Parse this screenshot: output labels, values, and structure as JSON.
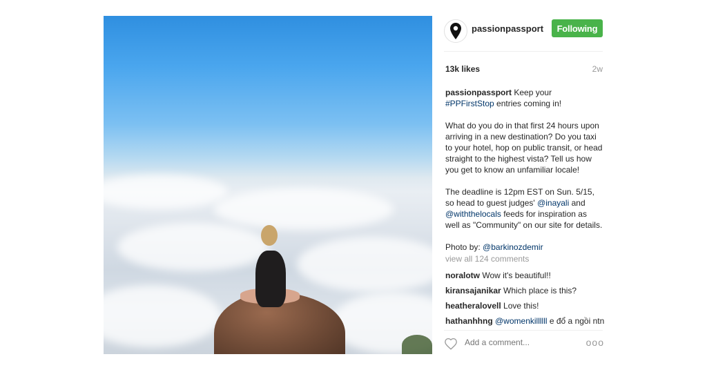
{
  "post": {
    "image_alt": "Person sitting on a rock above a sea of clouds"
  },
  "header": {
    "username": "passionpassport",
    "follow_label": "Following",
    "avatar_icon": "location-pin-icon"
  },
  "stats": {
    "likes": "13k likes",
    "time": "2w"
  },
  "caption": {
    "username": "passionpassport",
    "p1_text_a": " Keep your ",
    "hashtag": "#PPFirstStop",
    "p1_text_b": " entries coming in!",
    "p2": "What do you do in that first 24 hours upon arriving in a new destination? Do you taxi to your hotel, hop on public transit, or head straight to the highest vista? Tell us how you get to know an unfamiliar locale!",
    "p3_a": "The deadline is 12pm EST on Sun. 5/15, so head to guest judges' ",
    "mention1": "@inayali",
    "p3_b": " and ",
    "mention2": "@withthelocals",
    "p3_c": " feeds for inspiration as well as \"Community\" on our site for details.",
    "photo_by": "Photo by: ",
    "photographer": "@barkinozdemir"
  },
  "view_all": "view all 124 comments",
  "comments": [
    {
      "user": "noralotw",
      "text": " Wow it's beautiful!!"
    },
    {
      "user": "kiransajanikar",
      "text": " Which place is this?"
    },
    {
      "user": "heatheralovell",
      "text": " Love this!"
    },
    {
      "user": "hathanhhng",
      "mention": "@womenkillllll",
      "text": " e đổ a ngồi ntn"
    }
  ],
  "add_comment": {
    "placeholder": "Add a comment...",
    "more_label": "ooo",
    "heart_icon": "heart-outline-icon"
  }
}
